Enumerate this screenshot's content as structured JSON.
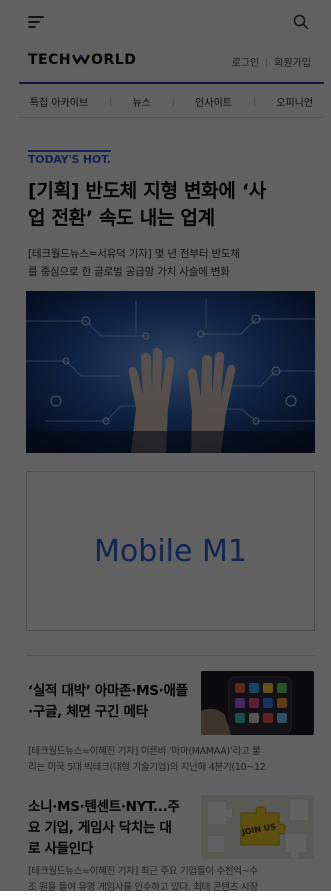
{
  "header": {
    "logo_text_left": "TECH",
    "logo_text_right": "ORLD",
    "login": "로그인",
    "signup": "회원가입"
  },
  "nav": {
    "items": [
      "특집 아카이브",
      "뉴스",
      "인사이트",
      "오피니언"
    ]
  },
  "hot": {
    "label": "TODAY'S HOT.",
    "headline_line1": "[기획] 반도체 지형 변화에 ‘사",
    "headline_line2": "업 전환’ 속도 내는 업계",
    "summary_line1": "[테크월드뉴스=서유덕 기자] 몇 년 전부터 반도체",
    "summary_line2": "를 중심으로 한 글로벌 공급망 가치 사슬에 변화"
  },
  "ad": {
    "text": "Mobile M1"
  },
  "articles": [
    {
      "title_line1": "‘실적 대박’ 아마존·MS·애플",
      "title_line2": "·구글, 체면 구긴 메타",
      "summary_line1": "[테크월드뉴스=이혜진 기자] 이른바 ‘마마(MAMAA)’라고 불",
      "summary_line2": "리는 미국 5대 빅테크(대형 기술기업)의 지난해 4분기(10~12"
    },
    {
      "title_line1": "소니·MS·텐센트·NYT...주",
      "title_line2": "요 기업, 게임사 닥치는 대",
      "title_line3": "로 사들인다",
      "summary_line1": "[테크월드뉴스=이혜진 기자] 최근 주요 기업들이 수천억~수",
      "summary_line2": "조 원을 들여 유명 게임사를 인수하고 있다. 최대 콘텐츠 시장",
      "thumb_text": "JOIN US"
    }
  ],
  "colors": {
    "accent_blue": "#3d5ad8",
    "nav_line": "#233a9c",
    "ad_text": "#2a63d4"
  }
}
